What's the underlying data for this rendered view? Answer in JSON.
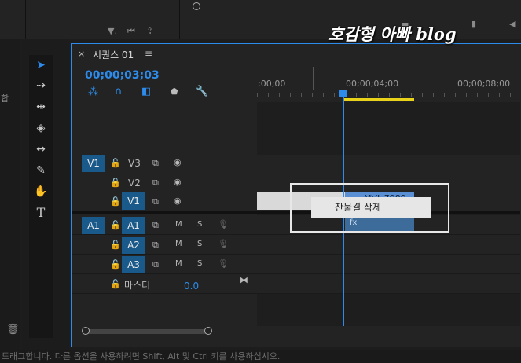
{
  "watermark": "호감형 아빠 blog",
  "sequence": {
    "tab_close": "×",
    "tab_title": "시퀀스 01",
    "tab_menu": "≡",
    "timecode": "00;00;03;03"
  },
  "ruler": {
    "labels": [
      ";00;00",
      "00;00;04;00",
      "00;00;08;00"
    ]
  },
  "tracks": {
    "video": [
      {
        "source": "V1",
        "name": "V3",
        "target": ""
      },
      {
        "source": "",
        "name": "V2",
        "target": ""
      },
      {
        "source": "",
        "name": "V1",
        "target": "V1"
      }
    ],
    "audio": [
      {
        "source": "A1",
        "name": "A1",
        "m": "M",
        "s": "S"
      },
      {
        "source": "",
        "name": "A2",
        "m": "M",
        "s": "S"
      },
      {
        "source": "",
        "name": "A3",
        "m": "M",
        "s": "S"
      }
    ],
    "master": {
      "label": "마스터",
      "value": "0.0"
    }
  },
  "clip_label": "MVI_7989",
  "context_menu": {
    "item": "잔물결 삭제"
  },
  "status_bar": "드래그합니다. 다른 옵션을 사용하려면 Shift, Alt 및 Ctrl 키를 사용하십시오.",
  "side_text": "합",
  "accent_color": "#2d8ceb",
  "target_color": "#1a5a8a",
  "workarea_color": "#e8d21a"
}
